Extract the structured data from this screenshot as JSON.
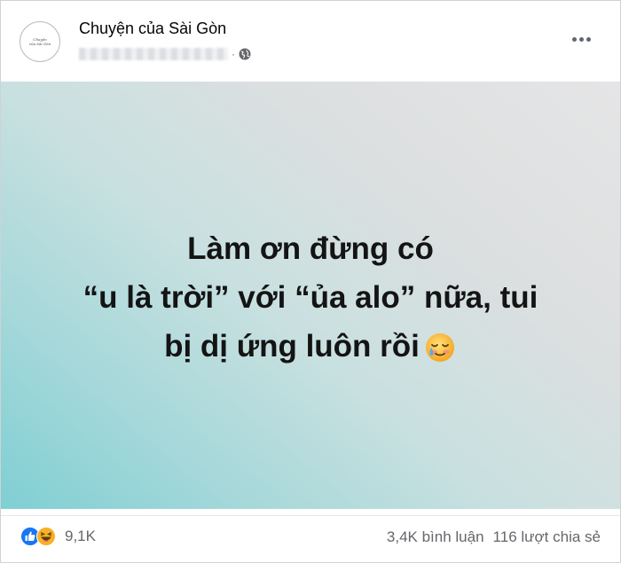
{
  "header": {
    "page_name": "Chuyện của Sài Gòn",
    "avatar_text": [
      "Chuyện",
      "của Sài Gòn"
    ],
    "privacy_icon": "globe-icon",
    "more_icon": "ellipsis-icon"
  },
  "post": {
    "lines": [
      "Làm ơn đừng có",
      "“u là trời” với “ủa alo” nữa, tui",
      "bị dị ứng luôn rồi"
    ],
    "emoji": "smiling-face-with-tear-icon",
    "background_colors": [
      "#7fcfd3",
      "#e5e5e6"
    ]
  },
  "footer": {
    "reaction_icons": [
      "like-icon",
      "haha-icon"
    ],
    "reaction_count": "9,1K",
    "comments": "3,4K bình luận",
    "shares": "116 lượt chia sẻ"
  },
  "colors": {
    "like_blue": "#1877f2",
    "haha_yellow": "#f7b125",
    "secondary_text": "#65676b"
  }
}
